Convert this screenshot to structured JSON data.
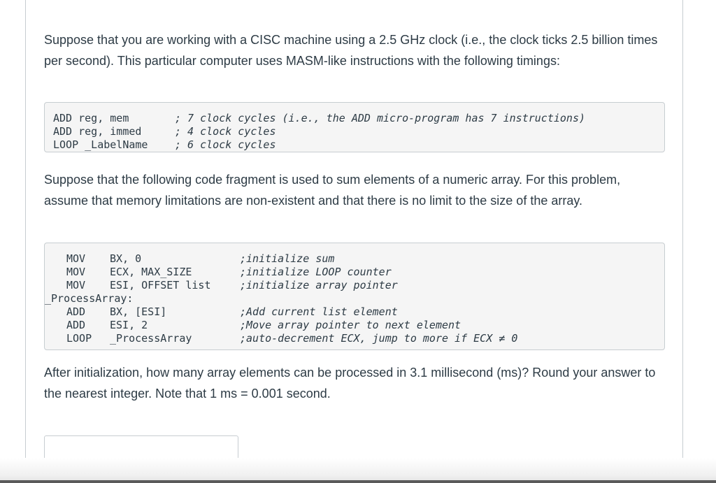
{
  "question": {
    "intro": "Suppose that you are working with a CISC machine using a 2.5 GHz clock (i.e., the clock ticks 2.5 billion times per second). This particular computer uses MASM-like instructions with the following timings:",
    "timings": [
      {
        "instr": "ADD reg, mem",
        "comment": "; 7 clock cycles (i.e., the ADD micro-program has 7 instructions)"
      },
      {
        "instr": "ADD reg, immed",
        "comment": "; 4 clock cycles"
      },
      {
        "instr": "LOOP _LabelName",
        "comment": "; 6 clock cycles"
      }
    ],
    "middle": "Suppose that the following code fragment is used to sum elements of a numeric array. For this problem, assume that memory limitations are non-existent and that there is no limit to the size of the array.",
    "code": [
      {
        "op": "MOV",
        "args": "BX, 0",
        "comment": ";initialize sum"
      },
      {
        "op": "MOV",
        "args": "ECX, MAX_SIZE",
        "comment": ";initialize LOOP counter"
      },
      {
        "op": "MOV",
        "args": "ESI, OFFSET list",
        "comment": ";initialize array pointer"
      },
      {
        "label": "_ProcessArray:"
      },
      {
        "op": "ADD",
        "args": "BX, [ESI]",
        "comment": ";Add current list element"
      },
      {
        "op": "ADD",
        "args": "ESI, 2",
        "comment": ";Move array pointer to next element"
      },
      {
        "op": "LOOP",
        "args": "_ProcessArray",
        "comment": ";auto-decrement ECX, jump to more if ECX ≠ 0"
      }
    ],
    "ask": "After initialization, how many array elements can be processed in 3.1 millisecond (ms)? Round your answer to the nearest integer. Note that 1 ms = 0.001 second."
  },
  "answer": {
    "value": ""
  }
}
